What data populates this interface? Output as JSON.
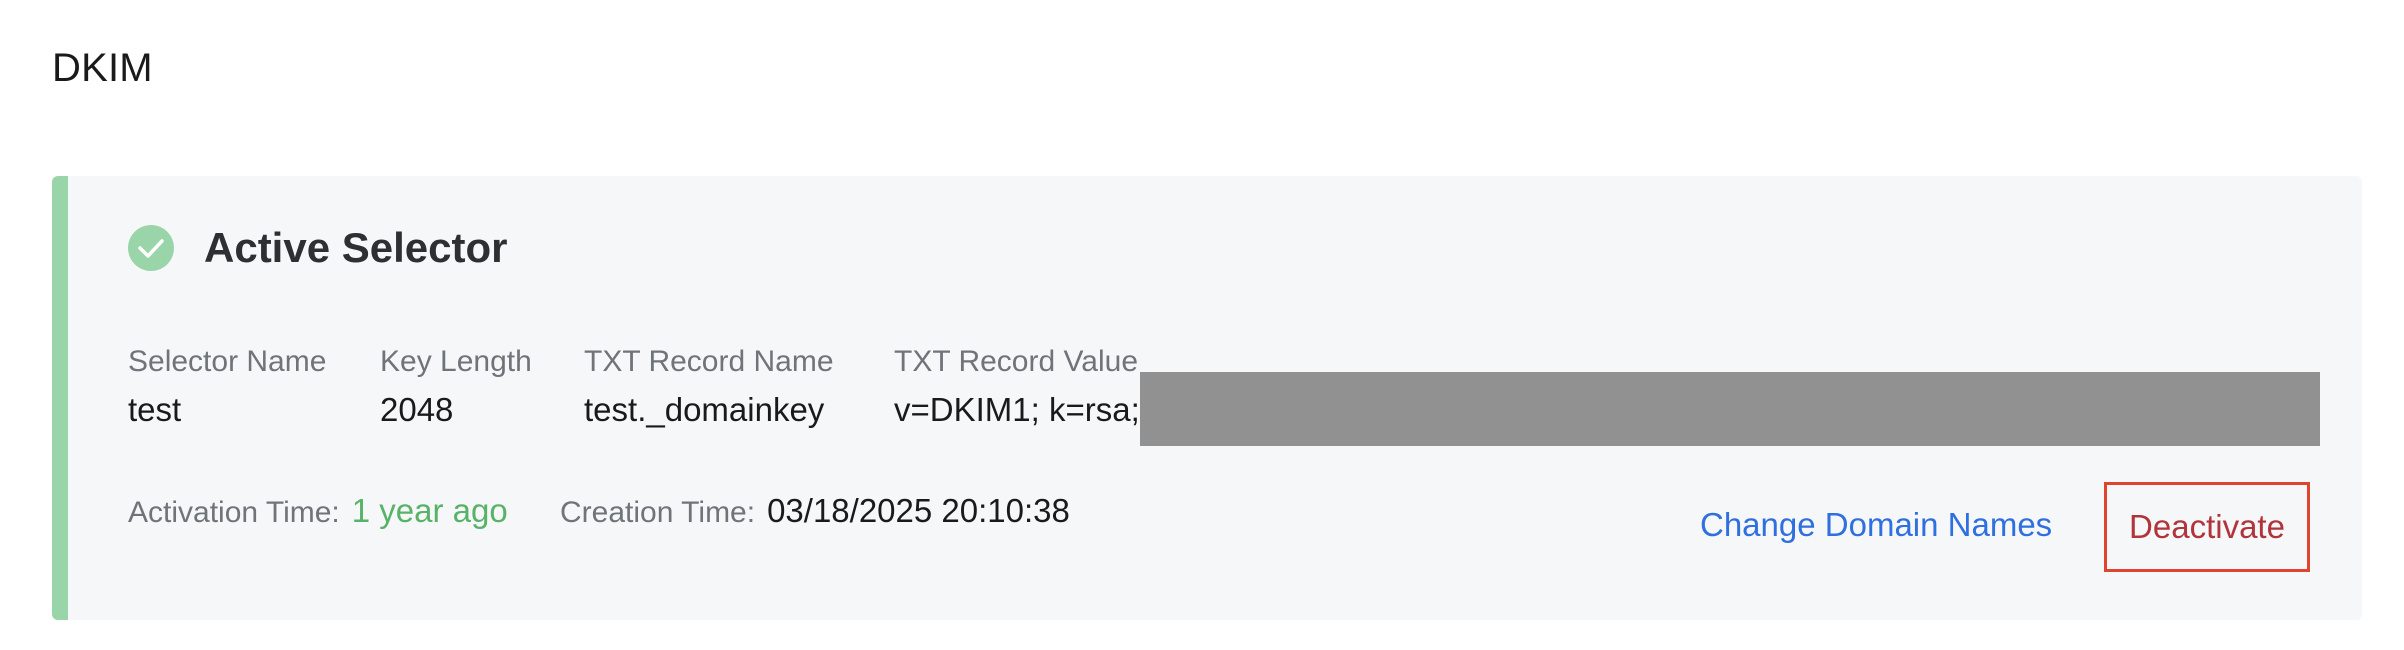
{
  "section": {
    "title": "DKIM"
  },
  "selector_card": {
    "status_icon": "check-circle-icon",
    "title": "Active Selector",
    "accent_color": "#9ad4a9",
    "fields": {
      "selector_name": {
        "label": "Selector Name",
        "value": "test"
      },
      "key_length": {
        "label": "Key Length",
        "value": "2048"
      },
      "txt_record_name": {
        "label": "TXT Record Name",
        "value": "test._domainkey"
      },
      "txt_record_value": {
        "label": "TXT Record Value",
        "value": "v=DKIM1; k=rsa; "
      }
    },
    "activation": {
      "label": "Activation Time:",
      "value": "1 year ago",
      "value_color": "#58b368"
    },
    "creation": {
      "label": "Creation Time:",
      "value": "03/18/2025 20:10:38"
    },
    "actions": {
      "change_domains_label": "Change Domain Names",
      "deactivate_label": "Deactivate"
    }
  }
}
